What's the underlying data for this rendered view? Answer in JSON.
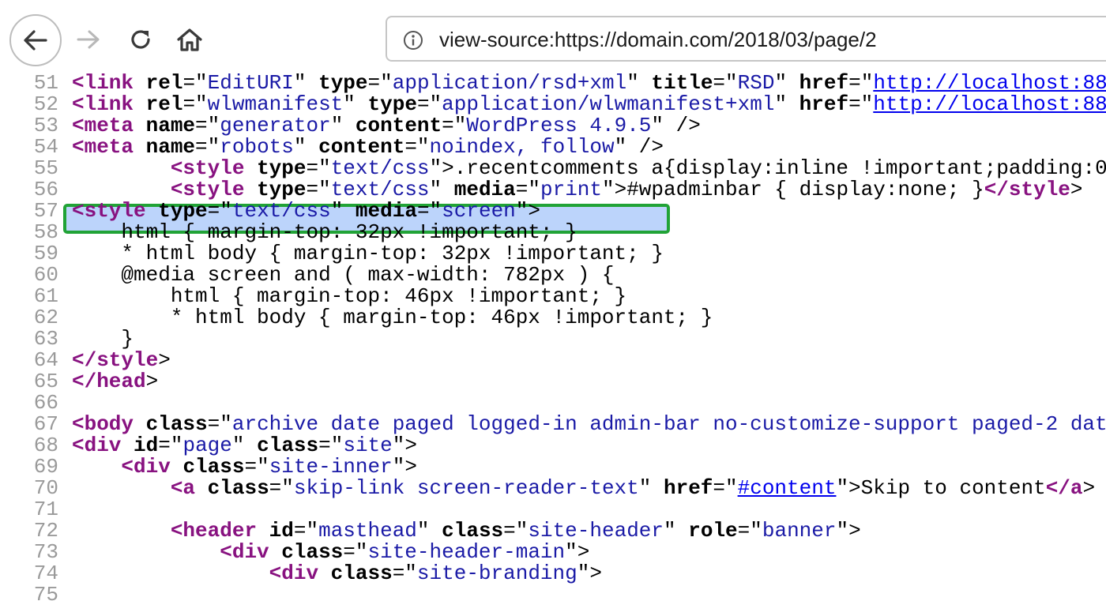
{
  "toolbar": {
    "url": "view-source:https://domain.com/2018/03/page/2",
    "icons": [
      "back-arrow-icon",
      "forward-arrow-icon",
      "reload-icon",
      "home-icon",
      "info-icon"
    ]
  },
  "colors": {
    "tag": "#881280",
    "attr_value": "#1a1aa6",
    "link": "#0000ee",
    "line_number": "#9a9a9a",
    "highlight_border": "#21a336",
    "highlight_fill": "#bcd4fb"
  },
  "source": {
    "highlighted_line": "54",
    "lines": [
      {
        "n": "51",
        "indent": "",
        "tokens": [
          [
            "tg",
            "<link"
          ],
          [
            "t",
            " "
          ],
          [
            "an",
            "rel"
          ],
          [
            "t",
            "=\""
          ],
          [
            "av",
            "EditURI"
          ],
          [
            "t",
            "\" "
          ],
          [
            "an",
            "type"
          ],
          [
            "t",
            "=\""
          ],
          [
            "av",
            "application/rsd+xml"
          ],
          [
            "t",
            "\" "
          ],
          [
            "an",
            "title"
          ],
          [
            "t",
            "=\""
          ],
          [
            "av",
            "RSD"
          ],
          [
            "t",
            "\" "
          ],
          [
            "an",
            "href"
          ],
          [
            "t",
            "=\""
          ],
          [
            "lk",
            "http://localhost:88"
          ]
        ]
      },
      {
        "n": "52",
        "indent": "",
        "tokens": [
          [
            "tg",
            "<link"
          ],
          [
            "t",
            " "
          ],
          [
            "an",
            "rel"
          ],
          [
            "t",
            "=\""
          ],
          [
            "av",
            "wlwmanifest"
          ],
          [
            "t",
            "\" "
          ],
          [
            "an",
            "type"
          ],
          [
            "t",
            "=\""
          ],
          [
            "av",
            "application/wlwmanifest+xml"
          ],
          [
            "t",
            "\" "
          ],
          [
            "an",
            "href"
          ],
          [
            "t",
            "=\""
          ],
          [
            "lk",
            "http://localhost:88"
          ]
        ]
      },
      {
        "n": "53",
        "indent": "",
        "tokens": [
          [
            "tg",
            "<meta"
          ],
          [
            "t",
            " "
          ],
          [
            "an",
            "name"
          ],
          [
            "t",
            "=\""
          ],
          [
            "av",
            "generator"
          ],
          [
            "t",
            "\" "
          ],
          [
            "an",
            "content"
          ],
          [
            "t",
            "=\""
          ],
          [
            "av",
            "WordPress 4.9.5"
          ],
          [
            "t",
            "\" />"
          ]
        ]
      },
      {
        "n": "54",
        "indent": "",
        "tokens": [
          [
            "tg",
            "<meta"
          ],
          [
            "t",
            " "
          ],
          [
            "an",
            "name"
          ],
          [
            "t",
            "=\""
          ],
          [
            "av",
            "robots"
          ],
          [
            "t",
            "\" "
          ],
          [
            "an",
            "content"
          ],
          [
            "t",
            "=\""
          ],
          [
            "av",
            "noindex, follow"
          ],
          [
            "t",
            "\" />"
          ]
        ]
      },
      {
        "n": "55",
        "indent": "        ",
        "tokens": [
          [
            "tg",
            "<style"
          ],
          [
            "t",
            " "
          ],
          [
            "an",
            "type"
          ],
          [
            "t",
            "=\""
          ],
          [
            "av",
            "text/css"
          ],
          [
            "t",
            "\">.recentcomments a{display:inline !important;padding:0"
          ]
        ]
      },
      {
        "n": "56",
        "indent": "        ",
        "tokens": [
          [
            "tg",
            "<style"
          ],
          [
            "t",
            " "
          ],
          [
            "an",
            "type"
          ],
          [
            "t",
            "=\""
          ],
          [
            "av",
            "text/css"
          ],
          [
            "t",
            "\" "
          ],
          [
            "an",
            "media"
          ],
          [
            "t",
            "=\""
          ],
          [
            "av",
            "print"
          ],
          [
            "t",
            "\">#wpadminbar { display:none; }"
          ],
          [
            "tg",
            "</style"
          ],
          [
            "t",
            ">"
          ]
        ]
      },
      {
        "n": "57",
        "indent": "",
        "tokens": [
          [
            "tg",
            "<style"
          ],
          [
            "t",
            " "
          ],
          [
            "an",
            "type"
          ],
          [
            "t",
            "=\""
          ],
          [
            "av",
            "text/css"
          ],
          [
            "t",
            "\" "
          ],
          [
            "an",
            "media"
          ],
          [
            "t",
            "=\""
          ],
          [
            "av",
            "screen"
          ],
          [
            "t",
            "\">"
          ]
        ]
      },
      {
        "n": "58",
        "indent": "    ",
        "tokens": [
          [
            "t",
            "html { margin-top: 32px !important; }"
          ]
        ]
      },
      {
        "n": "59",
        "indent": "    ",
        "tokens": [
          [
            "t",
            "* html body { margin-top: 32px !important; }"
          ]
        ]
      },
      {
        "n": "60",
        "indent": "    ",
        "tokens": [
          [
            "t",
            "@media screen and ( max-width: 782px ) {"
          ]
        ]
      },
      {
        "n": "61",
        "indent": "        ",
        "tokens": [
          [
            "t",
            "html { margin-top: 46px !important; }"
          ]
        ]
      },
      {
        "n": "62",
        "indent": "        ",
        "tokens": [
          [
            "t",
            "* html body { margin-top: 46px !important; }"
          ]
        ]
      },
      {
        "n": "63",
        "indent": "    ",
        "tokens": [
          [
            "t",
            "}"
          ]
        ]
      },
      {
        "n": "64",
        "indent": "",
        "tokens": [
          [
            "tg",
            "</style"
          ],
          [
            "t",
            ">"
          ]
        ]
      },
      {
        "n": "65",
        "indent": "",
        "tokens": [
          [
            "tg",
            "</head"
          ],
          [
            "t",
            ">"
          ]
        ]
      },
      {
        "n": "66",
        "indent": "",
        "tokens": []
      },
      {
        "n": "67",
        "indent": "",
        "tokens": [
          [
            "tg",
            "<body"
          ],
          [
            "t",
            " "
          ],
          [
            "an",
            "class"
          ],
          [
            "t",
            "=\""
          ],
          [
            "av",
            "archive date paged logged-in admin-bar no-customize-support paged-2 dat"
          ]
        ]
      },
      {
        "n": "68",
        "indent": "",
        "tokens": [
          [
            "tg",
            "<div"
          ],
          [
            "t",
            " "
          ],
          [
            "an",
            "id"
          ],
          [
            "t",
            "=\""
          ],
          [
            "av",
            "page"
          ],
          [
            "t",
            "\" "
          ],
          [
            "an",
            "class"
          ],
          [
            "t",
            "=\""
          ],
          [
            "av",
            "site"
          ],
          [
            "t",
            "\">"
          ]
        ]
      },
      {
        "n": "69",
        "indent": "    ",
        "tokens": [
          [
            "tg",
            "<div"
          ],
          [
            "t",
            " "
          ],
          [
            "an",
            "class"
          ],
          [
            "t",
            "=\""
          ],
          [
            "av",
            "site-inner"
          ],
          [
            "t",
            "\">"
          ]
        ]
      },
      {
        "n": "70",
        "indent": "        ",
        "tokens": [
          [
            "tg",
            "<a"
          ],
          [
            "t",
            " "
          ],
          [
            "an",
            "class"
          ],
          [
            "t",
            "=\""
          ],
          [
            "av",
            "skip-link screen-reader-text"
          ],
          [
            "t",
            "\" "
          ],
          [
            "an",
            "href"
          ],
          [
            "t",
            "=\""
          ],
          [
            "lk",
            "#content"
          ],
          [
            "t",
            "\">Skip to content"
          ],
          [
            "tg",
            "</a"
          ],
          [
            "t",
            ">"
          ]
        ]
      },
      {
        "n": "71",
        "indent": "",
        "tokens": []
      },
      {
        "n": "72",
        "indent": "        ",
        "tokens": [
          [
            "tg",
            "<header"
          ],
          [
            "t",
            " "
          ],
          [
            "an",
            "id"
          ],
          [
            "t",
            "=\""
          ],
          [
            "av",
            "masthead"
          ],
          [
            "t",
            "\" "
          ],
          [
            "an",
            "class"
          ],
          [
            "t",
            "=\""
          ],
          [
            "av",
            "site-header"
          ],
          [
            "t",
            "\" "
          ],
          [
            "an",
            "role"
          ],
          [
            "t",
            "=\""
          ],
          [
            "av",
            "banner"
          ],
          [
            "t",
            "\">"
          ]
        ]
      },
      {
        "n": "73",
        "indent": "            ",
        "tokens": [
          [
            "tg",
            "<div"
          ],
          [
            "t",
            " "
          ],
          [
            "an",
            "class"
          ],
          [
            "t",
            "=\""
          ],
          [
            "av",
            "site-header-main"
          ],
          [
            "t",
            "\">"
          ]
        ]
      },
      {
        "n": "74",
        "indent": "                ",
        "tokens": [
          [
            "tg",
            "<div"
          ],
          [
            "t",
            " "
          ],
          [
            "an",
            "class"
          ],
          [
            "t",
            "=\""
          ],
          [
            "av",
            "site-branding"
          ],
          [
            "t",
            "\">"
          ]
        ]
      },
      {
        "n": "75",
        "indent": "",
        "tokens": []
      }
    ]
  }
}
